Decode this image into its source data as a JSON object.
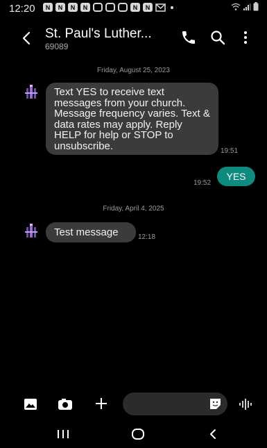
{
  "status_bar": {
    "time": "12:20",
    "notification_icons": [
      "notification-n-icon",
      "notification-n-icon",
      "notification-n-icon",
      "notification-n-icon",
      "instagram-icon",
      "instagram-icon",
      "instagram-icon",
      "notification-n-icon",
      "notification-n-icon",
      "gmail-icon"
    ],
    "right_icons": [
      "wifi-icon",
      "signal-icon",
      "battery-icon"
    ]
  },
  "header": {
    "title": "St. Paul's Luther...",
    "subtitle": "69089",
    "icons": [
      "back-icon",
      "phone-icon",
      "search-icon",
      "more-vert-icon"
    ]
  },
  "conversation": {
    "date_1": "Friday, August 25, 2023",
    "msg_in_1": {
      "text": "Text YES to receive text messages from your church. Message frequency varies. Text & data rates may apply. Reply HELP for help or STOP to unsubscribe.",
      "time": "19:51"
    },
    "msg_out_1": {
      "text": "YES",
      "time": "19:52"
    },
    "date_2": "Friday, April 4, 2025",
    "msg_in_2": {
      "text": "Test message",
      "time": "12:18"
    }
  },
  "composer": {
    "icons": [
      "gallery-icon",
      "camera-icon",
      "add-icon",
      "sticker-icon",
      "voice-icon"
    ],
    "placeholder": ""
  },
  "navbar": {
    "icons": [
      "recents-icon",
      "home-icon",
      "back-nav-icon"
    ]
  },
  "colors": {
    "background": "#000000",
    "incoming_bubble": "#3b3b3b",
    "outgoing_bubble": "#0e8a7e"
  }
}
